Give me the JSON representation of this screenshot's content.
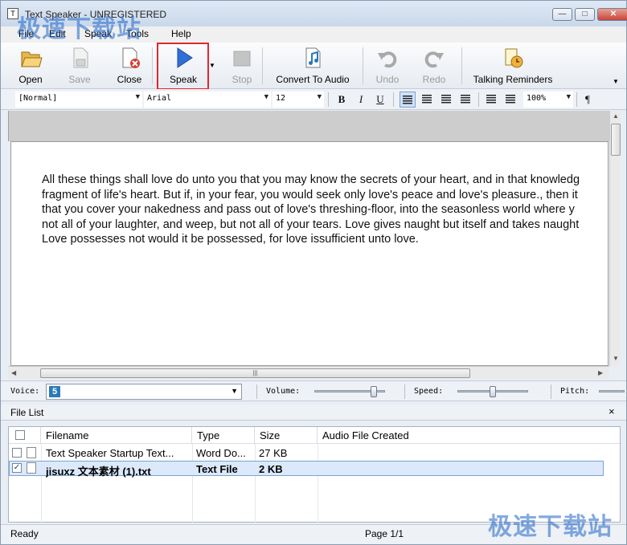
{
  "window": {
    "title": "Text Speaker - UNREGISTERED"
  },
  "watermark": "极速下载站",
  "menu": [
    "File",
    "Edit",
    "Speak",
    "Tools",
    "Help"
  ],
  "toolbar": {
    "open": "Open",
    "save": "Save",
    "close": "Close",
    "speak": "Speak",
    "stop": "Stop",
    "convert": "Convert To Audio",
    "undo": "Undo",
    "redo": "Redo",
    "reminders": "Talking Reminders"
  },
  "format": {
    "style": "[Normal]",
    "font": "Arial",
    "size": "12",
    "zoom": "100%",
    "bold": "B",
    "italic": "I",
    "underline": "U",
    "pilcrow": "¶"
  },
  "document": {
    "lines": [
      "All these things shall love do unto you that you may know the secrets of your heart, and in that knowledg",
      "fragment of life's heart. But if, in your fear, you would seek only love's peace and love's pleasure., then it",
      "that you cover your nakedness and pass out of love's threshing-floor, into the seasonless world where y",
      "not all of your laughter, and weep, but not all of your tears. Love gives naught but itself and takes naught",
      "Love possesses not would it be possessed, for love issufficient unto love."
    ]
  },
  "voicebar": {
    "voice_label": "Voice:",
    "voice_value": "5",
    "volume_label": "Volume:",
    "speed_label": "Speed:",
    "pitch_label": "Pitch:",
    "volume_level": 0.85,
    "speed_level": 0.5
  },
  "filelist": {
    "title": "File List",
    "close": "×",
    "columns": [
      "Filename",
      "Type",
      "Size",
      "Audio File Created"
    ],
    "rows": [
      {
        "filename": "Text Speaker Startup Text...",
        "type": "Word Do...",
        "size": "27 KB",
        "created": "",
        "checked": false
      },
      {
        "filename": "jisuxz 文本素材 (1).txt",
        "type": "Text File",
        "size": "2 KB",
        "created": "",
        "checked": true
      }
    ]
  },
  "status": {
    "left": "Ready",
    "page": "Page 1/1"
  }
}
